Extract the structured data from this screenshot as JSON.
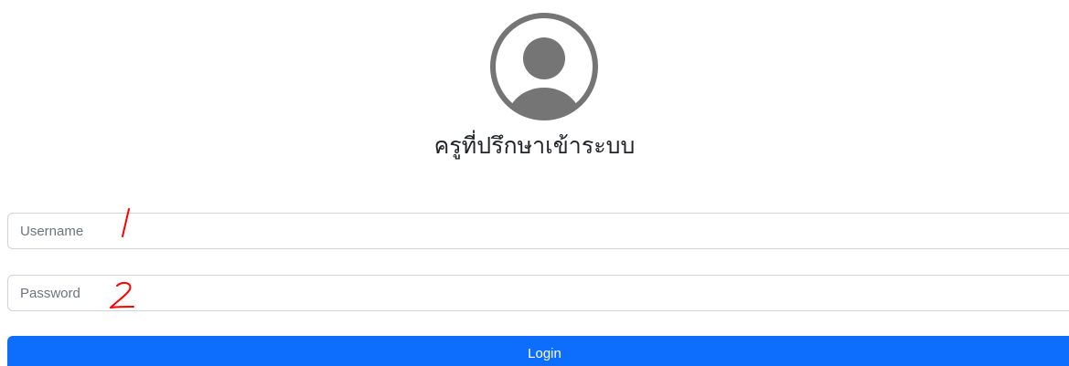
{
  "header": {
    "avatar_icon": "user-avatar-icon",
    "title": "ครูที่ปรึกษาเข้าระบบ"
  },
  "form": {
    "username_placeholder": "Username",
    "username_value": "",
    "password_placeholder": "Password",
    "password_value": "",
    "login_label": "Login"
  },
  "annotations": {
    "mark_1": "1",
    "mark_2": "2"
  },
  "colors": {
    "avatar": "#757575",
    "button": "#0d6efd",
    "field_border": "#ced4da",
    "annotation": "#ff0000"
  }
}
